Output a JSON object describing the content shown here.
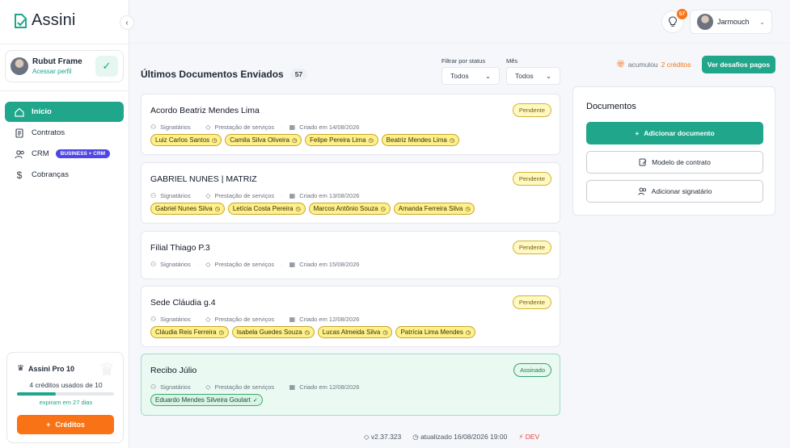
{
  "app": {
    "name": "Assini"
  },
  "profile": {
    "name": "Rubut Frame",
    "link": "Acessar perfil"
  },
  "nav": [
    {
      "label": "Início",
      "icon": "home-icon",
      "active": true
    },
    {
      "label": "Contratos",
      "icon": "document-icon"
    },
    {
      "label": "CRM",
      "icon": "users-icon",
      "badge": "BUSINESS + CRM"
    },
    {
      "label": "Cobranças",
      "icon": "dollar-icon"
    }
  ],
  "plan": {
    "title": "Assini Pro 10",
    "usage": "4 créditos usados de 10",
    "used_fraction": 0.4,
    "expire": "expiram em 27 dias",
    "button": "Créditos"
  },
  "topbar": {
    "notification_count": "57",
    "user": "Jarmouch"
  },
  "documents": {
    "title": "Últimos Documentos Enviados",
    "count": "57",
    "filter_status_label": "Filtrar por status",
    "filter_status_value": "Todos",
    "filter_month_label": "Mês",
    "filter_month_value": "Todos",
    "meta_signers": "Signatários",
    "items": [
      {
        "title": "Acordo Beatriz Mendes Lima",
        "status": "Pendente",
        "type": "Prestação de serviços",
        "created": "Criado em 14/08/2026",
        "signers": [
          "Luiz Carlos Santos",
          "Camila Silva Oliveira",
          "Felipe Pereira Lima",
          "Beatriz Mendes Lima"
        ]
      },
      {
        "title": "GABRIEL NUNES | MATRIZ",
        "status": "Pendente",
        "type": "Prestação de serviços",
        "created": "Criado em 13/08/2026",
        "signers": [
          "Gabriel Nunes Silva",
          "Letícia Costa Pereira",
          "Marcos Antônio Souza",
          "Amanda Ferreira Silva"
        ]
      },
      {
        "title": "Filial Thiago P.3",
        "status": "Pendente",
        "type": "Prestação de serviços",
        "created": "Criado em 15/08/2026",
        "signers": []
      },
      {
        "title": "Sede Cláudia g.4",
        "status": "Pendente",
        "type": "Prestação de serviços",
        "created": "Criado em 12/08/2026",
        "signers": [
          "Cláudia Reis Ferreira",
          "Isabela Guedes Souza",
          "Lucas Almeida Silva",
          "Patrícia Lima Mendes"
        ]
      },
      {
        "title": "Recibo Júlio",
        "status": "Assinado",
        "type": "Prestação de serviços",
        "created": "Criado em 12/08/2026",
        "signers": [
          "Eduardo Mendes Silveira Goulart"
        ]
      }
    ]
  },
  "right": {
    "earned_prefix": "acumulou",
    "earned_value": "2 créditos",
    "challenges_button": "Ver desafios pagos",
    "panel_title": "Documentos",
    "add_document": "Adicionar documento",
    "contract_model": "Modelo de contrato",
    "add_signer": "Adicionar signatário"
  },
  "footer": {
    "version": "v2.37.323",
    "updated": "atualizado 16/08/2026 19:00",
    "env": "DEV"
  },
  "colors": {
    "primary": "#20a68a",
    "accent": "#f97316",
    "badge": "#4f46e5"
  }
}
